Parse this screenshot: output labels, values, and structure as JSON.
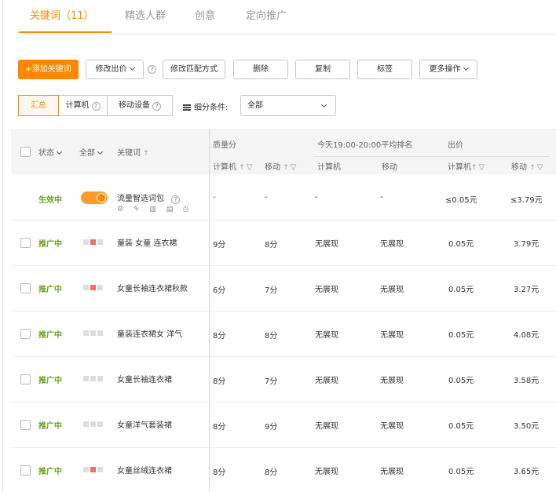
{
  "tabs": [
    {
      "label": "关键词（11）",
      "active": true
    },
    {
      "label": "精选人群",
      "active": false
    },
    {
      "label": "创意",
      "active": false
    },
    {
      "label": "定向推广",
      "active": false
    }
  ],
  "toolbar": {
    "add_keyword": "+添加关键词",
    "modify_bid": "修改出价",
    "modify_match": "修改匹配方式",
    "delete": "删除",
    "copy": "复制",
    "label": "标签",
    "more_actions": "更多操作"
  },
  "view": {
    "summary": "汇总",
    "computer": "计算机",
    "mobile": "移动设备",
    "filter_label": "细分条件:",
    "filter_value": "全部",
    "help_glyph": "?"
  },
  "table": {
    "headers": {
      "status": "状态",
      "all": "全部",
      "keyword": "关键词",
      "quality_score": "质量分",
      "qs_computer": "计算机",
      "qs_mobile": "移动",
      "ranking_group": "今天19:00-20:00平均排名",
      "rank_computer": "计算机",
      "rank_mobile": "移动",
      "bid_group": "出价",
      "bid_computer": "计算机",
      "bid_mobile": "移动",
      "sort_glyph": "↑",
      "filter_glyph": "▽"
    },
    "smart_row": {
      "status": "生效中",
      "keyword": "流量智选词包",
      "icons": "⚙ ✎ ▥ ▤ ⎙",
      "qs_computer": "-",
      "qs_mobile": "-",
      "rank_computer": "-",
      "rank_mobile": "-",
      "bid_computer": "≤0.05元",
      "bid_mobile": "≤3.79元"
    },
    "rows": [
      {
        "status": "推广中",
        "keyword": "童装 女童 连衣裙",
        "qs_computer": "9分",
        "qs_mobile": "8分",
        "rank_computer": "无展现",
        "rank_mobile": "无展现",
        "bid_computer": "0.05元",
        "bid_mobile": "3.79元",
        "marks": [
          "grey",
          "red",
          "grey"
        ]
      },
      {
        "status": "推广中",
        "keyword": "女童长袖连衣裙秋款",
        "qs_computer": "6分",
        "qs_mobile": "7分",
        "rank_computer": "无展现",
        "rank_mobile": "无展现",
        "bid_computer": "0.05元",
        "bid_mobile": "3.27元",
        "marks": [
          "grey",
          "red",
          "grey"
        ]
      },
      {
        "status": "推广中",
        "keyword": "童装连衣裙女 洋气",
        "qs_computer": "8分",
        "qs_mobile": "8分",
        "rank_computer": "无展现",
        "rank_mobile": "无展现",
        "bid_computer": "0.05元",
        "bid_mobile": "4.08元",
        "marks": [
          "grey",
          "grey",
          "grey"
        ]
      },
      {
        "status": "推广中",
        "keyword": "女童长袖连衣裙",
        "qs_computer": "8分",
        "qs_mobile": "7分",
        "rank_computer": "无展现",
        "rank_mobile": "无展现",
        "bid_computer": "0.05元",
        "bid_mobile": "3.58元",
        "marks": [
          "grey",
          "grey",
          "grey"
        ]
      },
      {
        "status": "推广中",
        "keyword": "女童洋气套装裙",
        "qs_computer": "8分",
        "qs_mobile": "9分",
        "rank_computer": "无展现",
        "rank_mobile": "无展现",
        "bid_computer": "0.05元",
        "bid_mobile": "3.50元",
        "marks": [
          "grey",
          "grey",
          "grey"
        ]
      },
      {
        "status": "推广中",
        "keyword": "女童丝绒连衣裙",
        "qs_computer": "8分",
        "qs_mobile": "8分",
        "rank_computer": "无展现",
        "rank_mobile": "无展现",
        "bid_computer": "0.05元",
        "bid_mobile": "3.65元",
        "marks": [
          "grey",
          "red",
          "grey"
        ]
      }
    ]
  },
  "colors": {
    "accent": "#ff8800",
    "status_green": "#6aa320",
    "mark_red": "#f56c6c",
    "mark_grey": "#dddddd"
  }
}
